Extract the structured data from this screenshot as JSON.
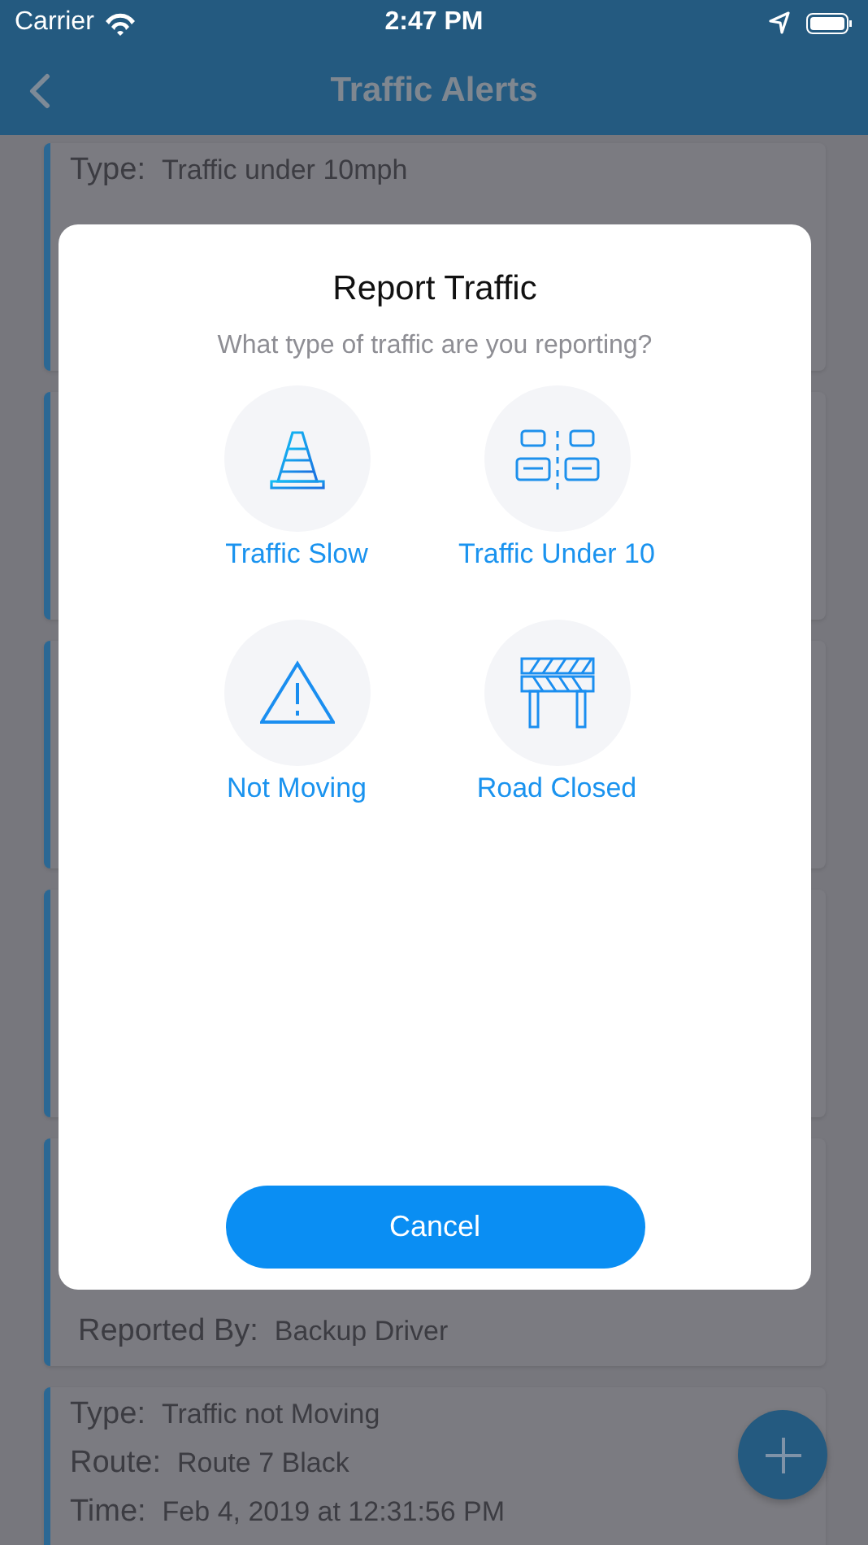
{
  "status_bar": {
    "carrier": "Carrier",
    "time": "2:47 PM"
  },
  "nav": {
    "title": "Traffic Alerts"
  },
  "alerts": [
    {
      "kind": "alert",
      "fields": [
        {
          "label": "Type:",
          "value": "Traffic under 10mph"
        }
      ]
    },
    {
      "kind": "alert"
    },
    {
      "kind": "alert"
    },
    {
      "kind": "alert"
    },
    {
      "kind": "alert",
      "fields": [
        {
          "label": "Reported By:",
          "value": "Backup Driver"
        }
      ]
    },
    {
      "kind": "alert",
      "fields": [
        {
          "label": "Type:",
          "value": "Traffic not Moving"
        },
        {
          "label": "Route:",
          "value": "Route 7 Black"
        },
        {
          "label": "Time:",
          "value": "Feb 4, 2019 at 12:31:56 PM"
        }
      ]
    }
  ],
  "dialog": {
    "title": "Report Traffic",
    "subtitle": "What type of traffic are you reporting?",
    "options": [
      {
        "kind": "cone",
        "label": "Traffic Slow"
      },
      {
        "kind": "cars",
        "label": "Traffic Under 10"
      },
      {
        "kind": "warning",
        "label": "Not Moving"
      },
      {
        "kind": "barrier",
        "label": "Road Closed"
      }
    ],
    "cancel": "Cancel"
  }
}
